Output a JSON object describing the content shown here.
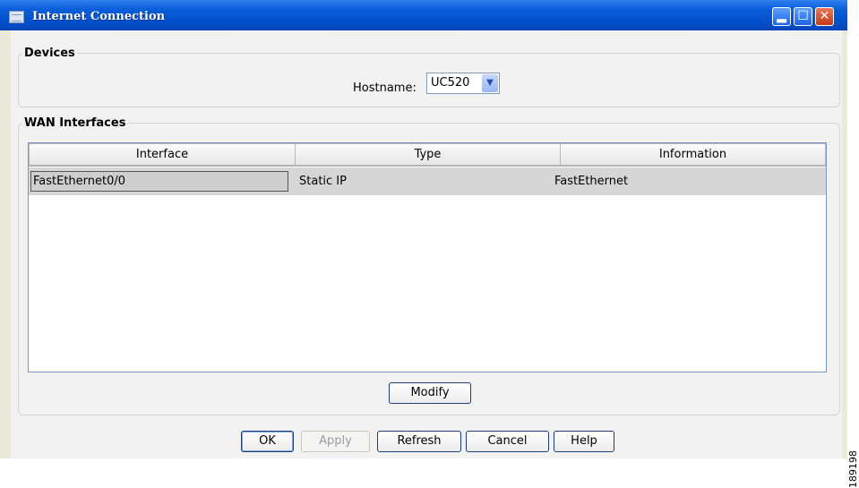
{
  "window": {
    "title": "Internet Connection",
    "buttons": [
      "minimize",
      "maximize",
      "close"
    ]
  },
  "devices": {
    "legend": "Devices",
    "hostname_label": "Hostname:",
    "hostname_value": "UC520"
  },
  "wan": {
    "legend": "WAN Interfaces",
    "columns": [
      "Interface",
      "Type",
      "Information"
    ],
    "rows": [
      {
        "interface": "FastEthernet0/0",
        "type": "Static IP",
        "information": "FastEthernet"
      }
    ],
    "modify_label": "Modify"
  },
  "footer": {
    "ok": "OK",
    "apply": "Apply",
    "refresh": "Refresh",
    "cancel": "Cancel",
    "help": "Help"
  },
  "figure_id": "189198",
  "colors": {
    "titlebar": "#0250cf",
    "panel_bg": "#f2f2f2",
    "selected_row": "#d6d6d6"
  }
}
